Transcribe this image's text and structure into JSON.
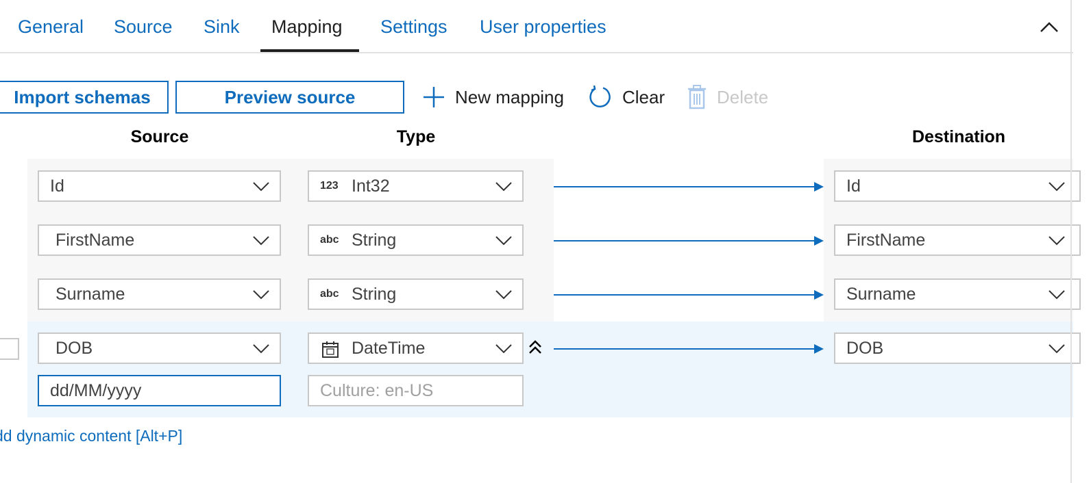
{
  "tabs": [
    {
      "label": "General"
    },
    {
      "label": "Source"
    },
    {
      "label": "Sink"
    },
    {
      "label": "Mapping"
    },
    {
      "label": "Settings"
    },
    {
      "label": "User properties"
    }
  ],
  "active_tab": "Mapping",
  "toolbar": {
    "import_label": "Import schemas",
    "preview_label": "Preview source",
    "new_mapping_label": "New mapping",
    "clear_label": "Clear",
    "delete_label": "Delete"
  },
  "columns": {
    "source": "Source",
    "type": "Type",
    "destination": "Destination"
  },
  "rows": [
    {
      "source": "Id",
      "type_icon": "123",
      "type": "Int32",
      "destination": "Id"
    },
    {
      "source": "FirstName",
      "type_icon": "abc",
      "type": "String",
      "destination": "FirstName"
    },
    {
      "source": "Surname",
      "type_icon": "abc",
      "type": "String",
      "destination": "Surname"
    },
    {
      "source": "DOB",
      "type_icon": "calendar-icon",
      "type": "DateTime",
      "destination": "DOB"
    }
  ],
  "dob_options": {
    "format_value": "dd/MM/yyyy",
    "culture_placeholder": "Culture: en-US"
  },
  "dynamic_content_link": "dd dynamic content [Alt+P]",
  "colors": {
    "accent": "#0f6cbd",
    "selected_row_bg": "#eef6fd",
    "row_bg": "#f7f7f7"
  }
}
